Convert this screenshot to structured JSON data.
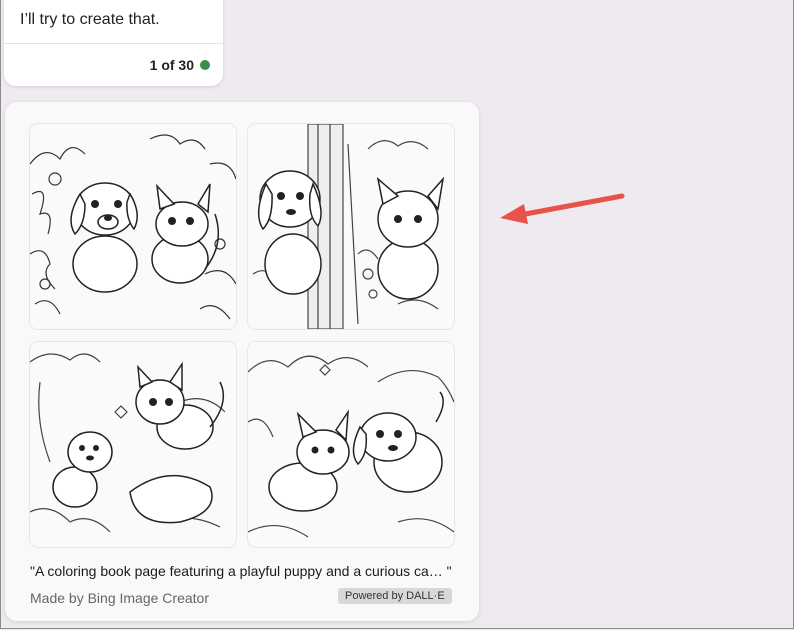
{
  "message": {
    "text": "I’ll try to create that.",
    "counter": "1 of 30",
    "status_color": "#3c8c4a"
  },
  "image_result": {
    "tiles": [
      {
        "subject": "puppy and kitten in garden"
      },
      {
        "subject": "puppy by tree and kitten"
      },
      {
        "subject": "puppy and kitten on log"
      },
      {
        "subject": "kitten and puppy in meadow"
      }
    ],
    "caption": "\"A coloring book page featuring a playful puppy and a curious ca… \"",
    "made_by": "Made by Bing Image Creator",
    "powered_by": "Powered by DALL·E"
  },
  "annotation": {
    "arrow_color": "#e8524a"
  }
}
